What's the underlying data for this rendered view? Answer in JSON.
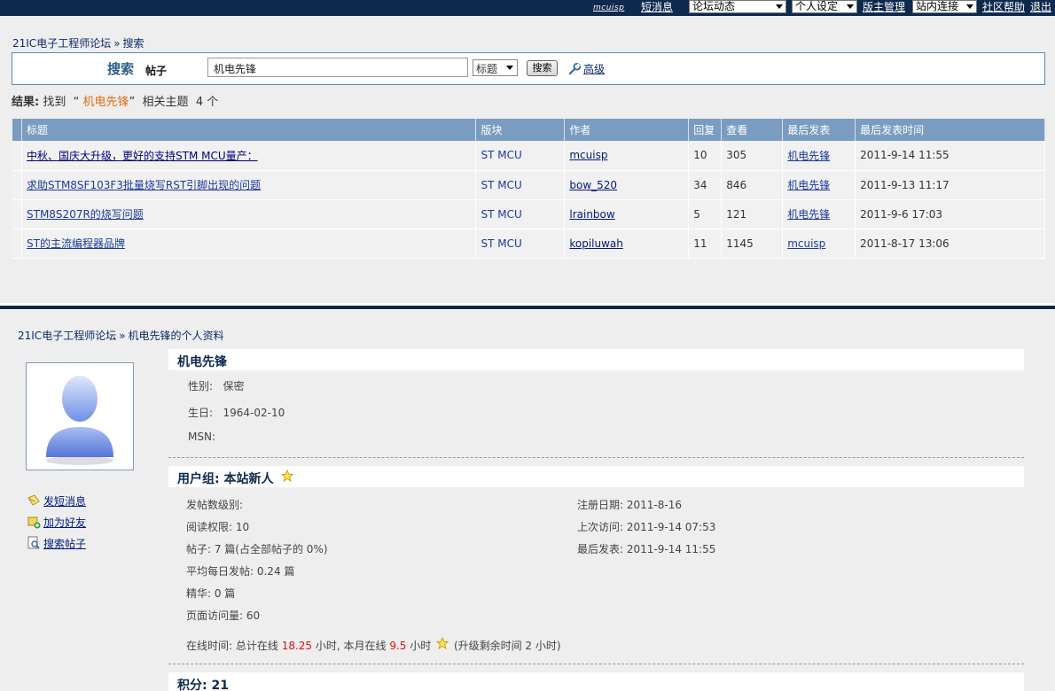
{
  "topbar": {
    "brand": "mcuisp",
    "short_msg": "短消息",
    "forum_dynamic": "论坛动态",
    "personal_settings": "个人设定",
    "moderator": "版主管理",
    "site_links": "站内连接",
    "help": "社区帮助",
    "logout": "退出"
  },
  "search_page": {
    "breadcrumb": {
      "home": "21IC电子工程师论坛",
      "sep": "»",
      "current": "搜索"
    },
    "search_label": "搜索",
    "search_sublabel": "帖子",
    "query": "机电先锋",
    "type_option": "标题",
    "search_button": "搜索",
    "advanced": "高级",
    "summary": {
      "prefix": "结果:",
      "found": "找到",
      "quote_open": "“",
      "keyword": "机电先锋",
      "quote_close": "”",
      "suffix": "相关主题",
      "count": "4",
      "unit": "个"
    },
    "columns": [
      "标题",
      "版块",
      "作者",
      "回复",
      "查看",
      "最后发表",
      "最后发表时间"
    ],
    "rows": [
      {
        "title": "中秋、国庆大升级，更好的支持STM MCU量产：",
        "forum": "ST MCU",
        "author": "mcuisp",
        "replies": "10",
        "views": "305",
        "last_poster": "机电先锋",
        "last_time": "2011-9-14 11:55"
      },
      {
        "title": "求助STM8SF103F3批量烧写RST引脚出现的问题",
        "forum": "ST MCU",
        "author": "bow_520",
        "replies": "34",
        "views": "846",
        "last_poster": "机电先锋",
        "last_time": "2011-9-13 11:17"
      },
      {
        "title": "STM8S207R的烧写问题",
        "forum": "ST MCU",
        "author": "lrainbow",
        "replies": "5",
        "views": "121",
        "last_poster": "机电先锋",
        "last_time": "2011-9-6 17:03"
      },
      {
        "title": "ST的主流编程器品牌",
        "forum": "ST MCU",
        "author": "kopiluwah",
        "replies": "11",
        "views": "1145",
        "last_poster": "mcuisp",
        "last_time": "2011-8-17 13:06"
      }
    ]
  },
  "profile": {
    "breadcrumb": {
      "home": "21IC电子工程师论坛",
      "sep": "»",
      "current": "机电先锋的个人资料"
    },
    "name": "机电先锋",
    "gender_label": "性别:",
    "gender": "保密",
    "birthday_label": "生日:",
    "birthday": "1964-02-10",
    "msn_label": "MSN:",
    "side_links": [
      "发短消息",
      "加为好友",
      "搜索帖子"
    ],
    "group_label": "用户组:",
    "group": "本站新人",
    "post_level": "发帖数级别:",
    "read_perm": "阅读权限: 10",
    "posts": "帖子: 7 篇(占全部帖子的 0%)",
    "avg_posts": "平均每日发帖: 0.24 篇",
    "digest": "精华: 0 篇",
    "page_views": "页面访问量: 60",
    "reg_date": "注册日期: 2011-8-16",
    "last_visit": "上次访问: 2011-9-14 07:53",
    "last_post": "最后发表: 2011-9-14 11:55",
    "online": {
      "prefix": "在线时间: 总计在线",
      "total": "18.25",
      "mid": "小时, 本月在线",
      "month": "9.5",
      "suffix": "小时",
      "upgrade": "(升级剩余时间 2 小时)"
    },
    "points_label": "积分:",
    "points": "21"
  },
  "colors": {
    "header_bg": "#0d2a4d",
    "table_header": "#7a9cc0",
    "keyword": "#e06a10",
    "highlight": "#d11111"
  }
}
